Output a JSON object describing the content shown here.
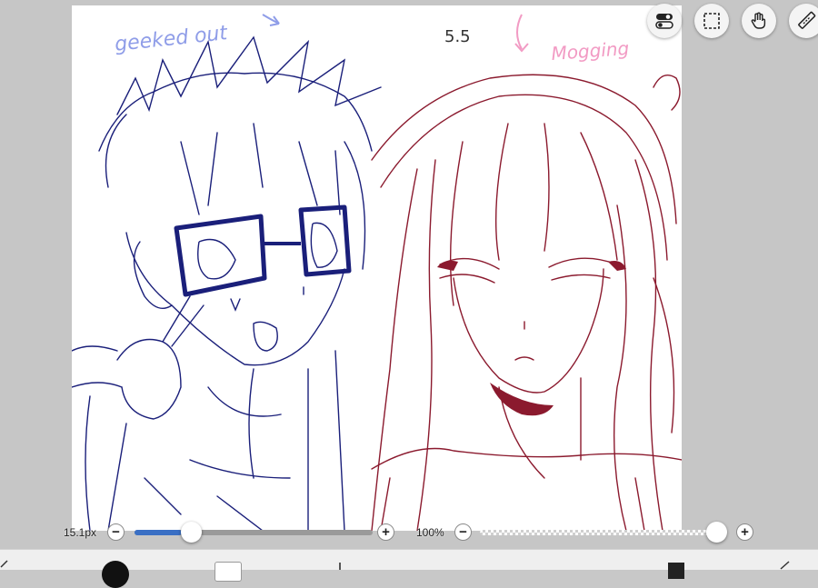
{
  "canvas": {
    "annotations": {
      "left_note": "geeked out",
      "center_note": "5.5",
      "right_note": "Mogging"
    },
    "colors": {
      "left_figure": "#1a1f7a",
      "right_figure": "#8b1a2e",
      "left_note": "#8f9de8",
      "right_note": "#f29bc4",
      "center_note": "#333333"
    }
  },
  "toolbar_top": {
    "buttons": [
      {
        "name": "toggle-icon"
      },
      {
        "name": "selection-icon"
      },
      {
        "name": "hand-icon"
      },
      {
        "name": "ruler-icon"
      }
    ]
  },
  "brush": {
    "size_label": "15.1px",
    "size_fraction": 0.2,
    "minus": "−",
    "plus": "+"
  },
  "opacity": {
    "label": "100%",
    "value_fraction": 1.0,
    "minus": "−",
    "plus": "+"
  },
  "ui_colors": {
    "accent": "#3a6fc4",
    "workspace": "#c6c6c6"
  }
}
